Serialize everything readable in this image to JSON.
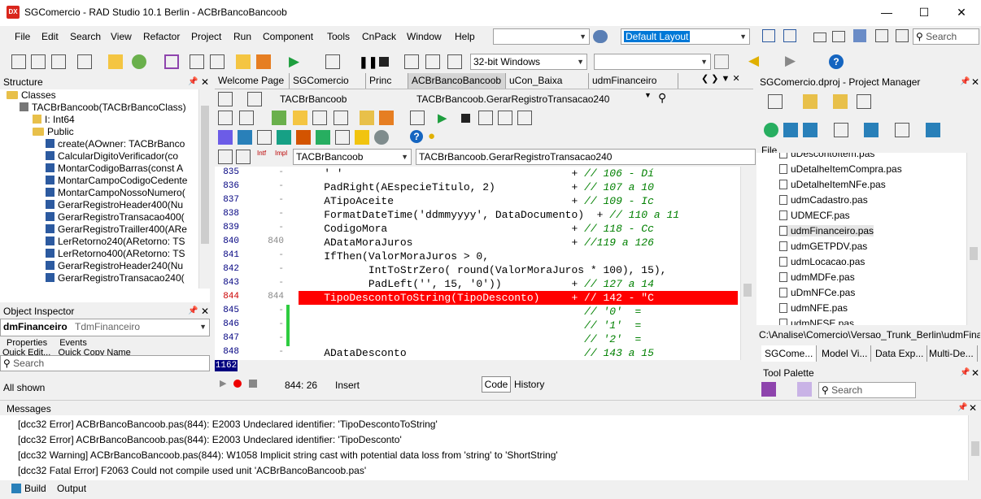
{
  "window": {
    "app_icon": "DX",
    "title": "SGComercio - RAD Studio 10.1 Berlin - ACBrBancoBancoob"
  },
  "menu": [
    "File",
    "Edit",
    "Search",
    "View",
    "Refactor",
    "Project",
    "Run",
    "Component",
    "Tools",
    "CnPack",
    "Window",
    "Help"
  ],
  "toolbar": {
    "layout": "Default Layout",
    "search_placeholder": "Search",
    "platform": "32-bit Windows"
  },
  "structure": {
    "header": "Structure",
    "items": [
      {
        "text": "Classes",
        "kind": "folder",
        "indent": 0
      },
      {
        "text": "TACBrBancoob(TACBrBancoClass)",
        "kind": "class",
        "indent": 1
      },
      {
        "text": "I: Int64",
        "kind": "field",
        "indent": 2
      },
      {
        "text": "Public",
        "kind": "folder",
        "indent": 2
      },
      {
        "text": "create(AOwner: TACBrBanco",
        "kind": "method",
        "indent": 3
      },
      {
        "text": "CalcularDigitoVerificador(co",
        "kind": "method",
        "indent": 3
      },
      {
        "text": "MontarCodigoBarras(const A",
        "kind": "method",
        "indent": 3
      },
      {
        "text": "MontarCampoCodigoCedente",
        "kind": "method",
        "indent": 3
      },
      {
        "text": "MontarCampoNossoNumero(",
        "kind": "method",
        "indent": 3
      },
      {
        "text": "GerarRegistroHeader400(Nu",
        "kind": "method",
        "indent": 3
      },
      {
        "text": "GerarRegistroTransacao400(",
        "kind": "method",
        "indent": 3
      },
      {
        "text": "GerarRegistroTrailler400(ARe",
        "kind": "method",
        "indent": 3
      },
      {
        "text": "LerRetorno240(ARetorno: TS",
        "kind": "method",
        "indent": 3
      },
      {
        "text": "LerRetorno400(ARetorno: TS",
        "kind": "method",
        "indent": 3
      },
      {
        "text": "GerarRegistroHeader240(Nu",
        "kind": "method",
        "indent": 3
      },
      {
        "text": "GerarRegistroTransacao240(",
        "kind": "method",
        "indent": 3
      }
    ]
  },
  "inspector": {
    "header": "Object Inspector",
    "object": "dmFinanceiro",
    "type": "TdmFinanceiro",
    "tabs": [
      "Properties",
      "Events"
    ],
    "quick": "Quick Edit...   Quick Copy Name",
    "search_placeholder": "Search",
    "footer": "All shown"
  },
  "editor": {
    "tabs": [
      "Welcome Page",
      "SGComercio",
      "Princ",
      "ACBrBancoBancoob",
      "uCon_Baixa",
      "udmFinanceiro"
    ],
    "class_combo": "TACBrBancoob",
    "method_combo": "TACBrBancoob.GerarRegistroTransacao240",
    "class_combo2": "TACBrBancoob",
    "method_combo2": "TACBrBancoob.GerarRegistroTransacao240",
    "lines": [
      {
        "num": "835",
        "mark": "",
        "code": "    ' '                                    + // 106 - Dí",
        "err": false
      },
      {
        "num": "836",
        "mark": "",
        "code": "    PadRight(AEspecieTitulo, 2)            + // 107 a 10",
        "err": false
      },
      {
        "num": "837",
        "mark": "",
        "code": "    ATipoAceite                            + // 109 - Ic",
        "err": false
      },
      {
        "num": "838",
        "mark": "",
        "code": "    FormatDateTime('ddmmyyyy', DataDocumento)  + // 110 a 11",
        "err": false
      },
      {
        "num": "839",
        "mark": "",
        "code": "    CodigoMora                             + // 118 - Cc",
        "err": false
      },
      {
        "num": "840",
        "mark": "840",
        "code": "    ADataMoraJuros                         + //119 a 126",
        "err": false
      },
      {
        "num": "841",
        "mark": "",
        "code": "    IfThen(ValorMoraJuros > 0,",
        "err": false
      },
      {
        "num": "842",
        "mark": "",
        "code": "           IntToStrZero( round(ValorMoraJuros * 100), 15),",
        "err": false
      },
      {
        "num": "843",
        "mark": "",
        "code": "           PadLeft('', 15, '0'))           + // 127 a 14",
        "err": false
      },
      {
        "num": "844",
        "mark": "844",
        "code": "    TipoDescontoToString(TipoDesconto)     + // 142 - \"C",
        "err": true
      },
      {
        "num": "845",
        "mark": "",
        "code": "                                             // '0'  =",
        "err": false
      },
      {
        "num": "846",
        "mark": "",
        "code": "                                             // '1'  =",
        "err": false
      },
      {
        "num": "847",
        "mark": "",
        "code": "                                             // '2'  =",
        "err": false
      },
      {
        "num": "848",
        "mark": "",
        "code": "    ADataDesconto                            // 143 a 15",
        "err": false
      }
    ],
    "current_line": "1162",
    "cursor": "844:  26",
    "mode": "Insert",
    "bottom_tabs": [
      "Code",
      "History"
    ]
  },
  "project": {
    "header": "SGComercio.dproj - Project Manager",
    "file_label": "File",
    "files": [
      "uDescontoItem.pas",
      "uDetalheItemCompra.pas",
      "uDetalheItemNFe.pas",
      "udmCadastro.pas",
      "UDMECF.pas",
      "udmFinanceiro.pas",
      "udmGETPDV.pas",
      "udmLocacao.pas",
      "udmMDFe.pas",
      "uDmNFCe.pas",
      "udmNFE.pas",
      "udmNFSE.pas"
    ],
    "path": "C:\\Analise\\Comercio\\Versao_Trunk_Berlin\\udmFina",
    "tabs": [
      "SGCome...",
      "Model Vi...",
      "Data Exp...",
      "Multi-De..."
    ]
  },
  "palette": {
    "header": "Tool Palette",
    "search_placeholder": "Search"
  },
  "messages": {
    "header": "Messages",
    "items": [
      "[dcc32 Error] ACBrBancoBancoob.pas(844): E2003 Undeclared identifier: 'TipoDescontoToString'",
      "[dcc32 Error] ACBrBancoBancoob.pas(844): E2003 Undeclared identifier: 'TipoDesconto'",
      "[dcc32 Warning] ACBrBancoBancoob.pas(844): W1058 Implicit string cast with potential data loss from 'string' to 'ShortString'",
      "[dcc32 Fatal Error] F2063 Could not compile used unit 'ACBrBancoBancoob.pas'"
    ],
    "tabs": [
      "Build",
      "Output"
    ]
  },
  "colors": {
    "error_line": "#ff0000",
    "accent": "#0078d7",
    "string_literal": "#0000ff",
    "comment": "#008000"
  }
}
